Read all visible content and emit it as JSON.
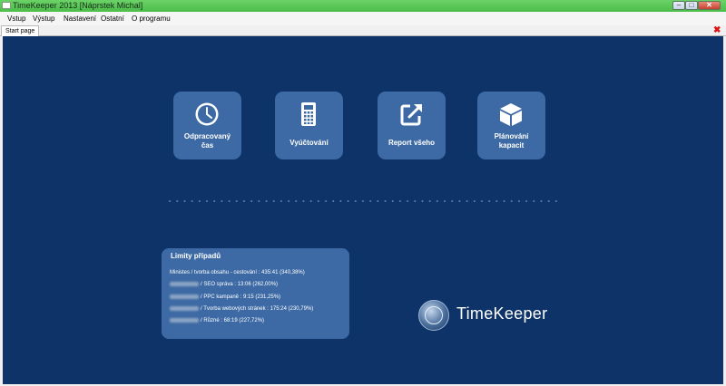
{
  "window": {
    "title": "TimeKeeper 2013 [Náprstek Michal]",
    "minimize_glyph": "–",
    "maximize_glyph": "□",
    "close_glyph": "✕",
    "accent_color": "#4bbd49"
  },
  "menu": {
    "items": [
      "Vstup",
      "Výstup",
      "Nastavení",
      "Ostatní",
      "O programu"
    ]
  },
  "tabs": {
    "active_label": "Start page",
    "close_glyph": "✖"
  },
  "tiles": [
    {
      "label_line1": "Odpracovaný",
      "label_line2": "čas",
      "icon": "clock-icon"
    },
    {
      "label_line1": "Vyúčtování",
      "label_line2": "",
      "icon": "calculator-icon"
    },
    {
      "label_line1": "Report všeho",
      "label_line2": "",
      "icon": "external-link-icon"
    },
    {
      "label_line1": "Plánování",
      "label_line2": "kapacit",
      "icon": "box-icon"
    }
  ],
  "limits": {
    "title": "Limity případů",
    "rows": [
      {
        "prefix": "Ministes",
        "text": "Ministes / tvorba obsahu - cestování : 435:41 (340,38%)",
        "obscured": false
      },
      {
        "prefix": "",
        "text": "/ SEO správa : 13:06 (262,00%)",
        "obscured": true
      },
      {
        "prefix": "",
        "text": "/ PPC kampaně : 9:15 (231,25%)",
        "obscured": true
      },
      {
        "prefix": "",
        "text": "/ Tvorba webových stránek : 175:24 (230,79%)",
        "obscured": true
      },
      {
        "prefix": "",
        "text": "/ Různé : 68:19 (227,72%)",
        "obscured": true
      }
    ]
  },
  "logo": {
    "text": "TimeKeeper"
  },
  "colors": {
    "background": "#0d3369",
    "tile": "#3d6aa4",
    "close_tab": "#dd1111"
  }
}
